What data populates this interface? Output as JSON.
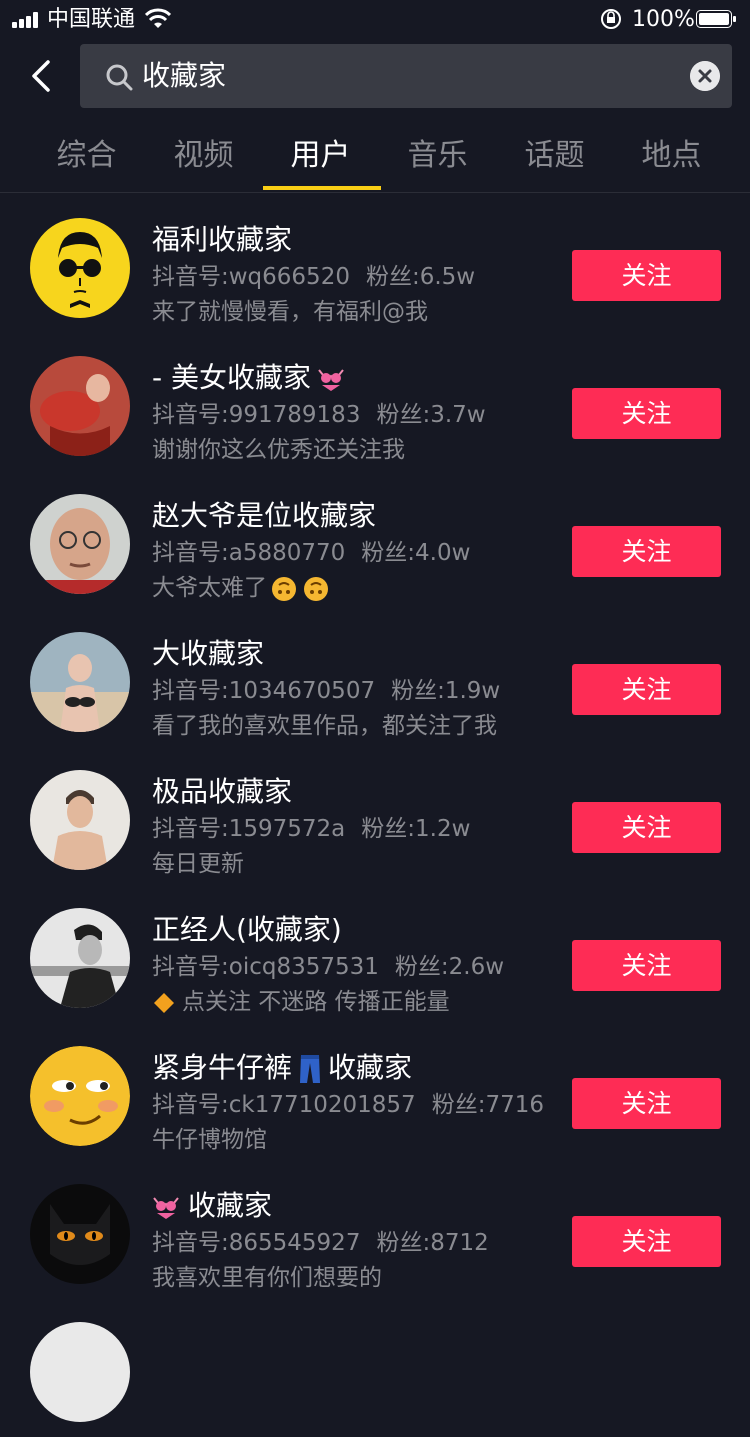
{
  "status_bar": {
    "carrier": "中国联通",
    "battery": "100%"
  },
  "search": {
    "query": "收藏家"
  },
  "tabs": [
    "综合",
    "视频",
    "用户",
    "音乐",
    "话题",
    "地点"
  ],
  "active_tab": "用户",
  "meta_labels": {
    "id_prefix": "抖音号:",
    "fans_prefix": "粉丝:"
  },
  "users": [
    {
      "nickname": "福利收藏家",
      "douyin_id": "wq666520",
      "fans": "6.5w",
      "bio": "来了就慢慢看，有福利@我",
      "follow_label": "关注",
      "avatar": "cartoon-face-avatar"
    },
    {
      "nickname": "- 美女收藏家",
      "nickname_emoji": "bikini-icon",
      "douyin_id": "991789183",
      "fans": "3.7w",
      "bio": "谢谢你这么优秀还关注我",
      "follow_label": "关注",
      "avatar": "red-dress-photo-avatar"
    },
    {
      "nickname": "赵大爷是位收藏家",
      "douyin_id": "a5880770",
      "fans": "4.0w",
      "bio": "大爷太难了",
      "bio_emoji": "upside-down-face-icon",
      "follow_label": "关注",
      "avatar": "old-man-photo-avatar"
    },
    {
      "nickname": "大收藏家",
      "douyin_id": "1034670507",
      "fans": "1.9w",
      "bio": "看了我的喜欢里作品，都关注了我",
      "follow_label": "关注",
      "avatar": "beach-photo-avatar"
    },
    {
      "nickname": "极品收藏家",
      "douyin_id": "1597572a",
      "fans": "1.2w",
      "bio": "每日更新",
      "follow_label": "关注",
      "avatar": "young-man-photo-avatar"
    },
    {
      "nickname": "正经人(收藏家)",
      "douyin_id": "oicq8357531",
      "fans": "2.6w",
      "bio": "点关注 不迷路 传播正能量",
      "bio_emoji": "orange-diamond-icon",
      "follow_label": "关注",
      "avatar": "bw-portrait-avatar"
    },
    {
      "nickname": "紧身牛仔裤",
      "nickname_suffix": "收藏家",
      "nickname_emoji": "jeans-icon",
      "douyin_id": "ck17710201857",
      "fans": "7716",
      "bio": "牛仔博物馆",
      "follow_label": "关注",
      "avatar": "smirk-emoji-avatar"
    },
    {
      "nickname": "收藏家",
      "nickname_emoji": "bikini-icon",
      "douyin_id": "865545927",
      "fans": "8712",
      "bio": "我喜欢里有你们想要的",
      "follow_label": "关注",
      "avatar": "black-cat-avatar"
    }
  ],
  "colors": {
    "background": "#161823",
    "accent": "#fe2c55",
    "tab_indicator": "#face15",
    "secondary_text": "#8a8b91"
  }
}
